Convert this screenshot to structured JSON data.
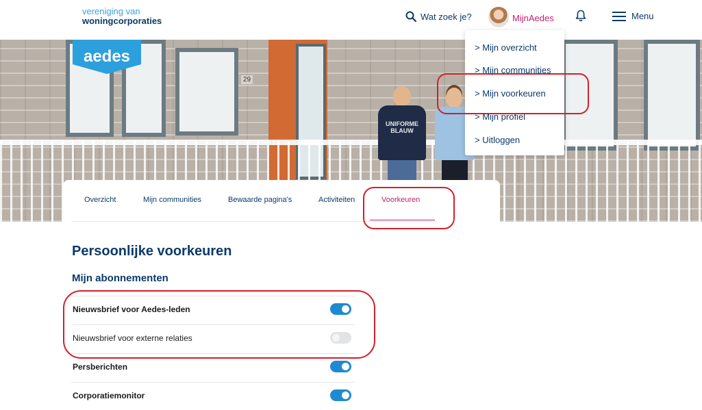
{
  "header": {
    "org_line1": "vereniging van",
    "org_line2": "woningcorporaties",
    "search_label": "Wat zoek je?",
    "account_label": "MijnAedes",
    "menu_label": "Menu"
  },
  "logo": {
    "text": "aedes"
  },
  "hero": {
    "house_number": "29",
    "shirt_text": "UNIFORME BLAUW"
  },
  "user_menu": {
    "items": [
      {
        "label": "> Mijn overzicht"
      },
      {
        "label": "> Mijn communities"
      },
      {
        "label": "> Mijn voorkeuren"
      },
      {
        "label": "> Mijn profiel"
      },
      {
        "label": "> Uitloggen"
      }
    ]
  },
  "tabs": {
    "items": [
      {
        "label": "Overzicht"
      },
      {
        "label": "Mijn communities"
      },
      {
        "label": "Bewaarde pagina's"
      },
      {
        "label": "Activiteiten"
      },
      {
        "label": "Voorkeuren"
      }
    ],
    "active": "Voorkeuren"
  },
  "page": {
    "title": "Persoonlijke voorkeuren",
    "section_title": "Mijn abonnementen"
  },
  "subscriptions": [
    {
      "label": "Nieuwsbrief voor Aedes-leden",
      "enabled": true
    },
    {
      "label": "Nieuwsbrief voor externe relaties",
      "enabled": false
    },
    {
      "label": "Persberichten",
      "enabled": true
    },
    {
      "label": "Corporatiemonitor",
      "enabled": true
    }
  ],
  "colors": {
    "brand_blue": "#0b3a68",
    "accent_magenta": "#c4206e",
    "toggle_on": "#1e8ad2",
    "annotation_red": "#d0202b"
  }
}
